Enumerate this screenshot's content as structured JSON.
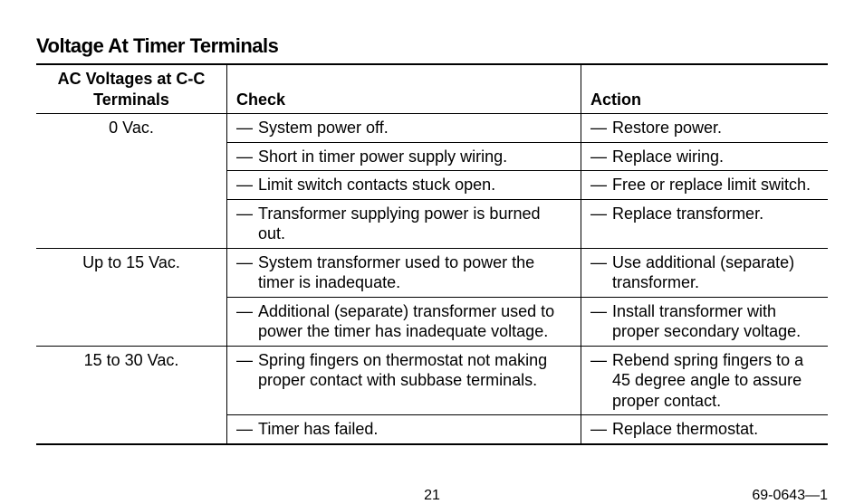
{
  "title": "Voltage At Timer Terminals",
  "columns": {
    "voltage": "AC Voltages at C-C Terminals",
    "check": "Check",
    "action": "Action"
  },
  "groups": [
    {
      "voltage": "0 Vac.",
      "rows": [
        {
          "check": "System power off.",
          "action": "Restore power."
        },
        {
          "check": "Short in timer power supply wiring.",
          "action": "Replace wiring."
        },
        {
          "check": "Limit switch contacts stuck open.",
          "action": "Free or replace limit switch."
        },
        {
          "check": "Transformer supplying power is burned out.",
          "action": "Replace transformer."
        }
      ]
    },
    {
      "voltage": "Up to 15 Vac.",
      "rows": [
        {
          "check": "System transformer used to power the timer is inadequate.",
          "action": "Use additional (separate) transformer."
        },
        {
          "check": "Additional (separate) transformer used to power the timer has inadequate voltage.",
          "action": "Install transformer with proper secondary voltage."
        }
      ]
    },
    {
      "voltage": "15 to 30 Vac.",
      "rows": [
        {
          "check": "Spring fingers on thermostat not making proper contact with subbase terminals.",
          "action": "Rebend spring fingers to a 45 degree angle to assure proper contact."
        },
        {
          "check": "Timer has failed.",
          "action": "Replace thermostat."
        }
      ]
    }
  ],
  "page_number": "21",
  "doc_number": "69-0643—1",
  "dash": "—"
}
